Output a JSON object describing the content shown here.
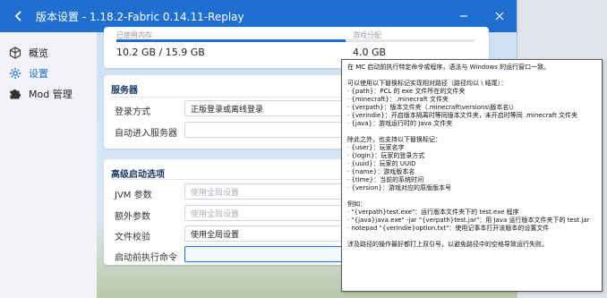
{
  "window": {
    "title": "版本设置 - 1.18.2-Fabric 0.14.11-Replay"
  },
  "sidebar": {
    "items": [
      {
        "label": "概览",
        "icon": "cube-icon"
      },
      {
        "label": "设置",
        "icon": "gear-icon",
        "active": true
      },
      {
        "label": "Mod 管理",
        "icon": "puzzle-icon"
      }
    ]
  },
  "memory": {
    "used_label": "已使用内存",
    "alloc_label": "游戏分配",
    "used_value": "10.2 GB / 15.9 GB",
    "alloc_value": "4.0 GB",
    "used_fraction": 0.64
  },
  "server": {
    "title": "服务器",
    "login_label": "登录方式",
    "login_value": "正版登录或离线登录",
    "auto_join_label": "自动进入服务器",
    "auto_join_value": ""
  },
  "advanced": {
    "title": "高级启动选项",
    "jvm_label": "JVM 参数",
    "jvm_placeholder": "使用全局设置",
    "extra_label": "额外参数",
    "extra_placeholder": "使用全局设置",
    "check_label": "文件校验",
    "check_value": "使用全局设置",
    "pre_cmd_label": "启动前执行命令",
    "pre_cmd_value": ""
  },
  "tooltip": {
    "lines": [
      "在 MC 启动前执行特定命令或程序，语法与 Windows 的运行窗口一致。",
      "",
      "可以使用以下替换标记实现相对路径（路径均以 \\ 结尾）：",
      "· {path}：PCL 的 exe 文件所在的文件夹",
      "· {minecraft}：.minecraft 文件夹",
      "· {verpath}：版本文件夹（.minecraft\\versions\\版本名\\）",
      "· {verindie}：开启版本隔离时等同版本文件夹，未开启时等同 .minecraft 文件夹",
      "· {java}：游戏运行时的 Java 文件夹",
      "",
      "除此之外，也支持以下替换标记：",
      "· {user}：玩家名字",
      "· {login}：玩家的登录方式",
      "· {uuid}：玩家的 UUID",
      "· {name}：游戏版本名",
      "· {time}：当前的系统时间",
      "· {version}：游戏对应的原版版本号",
      "",
      "例如：",
      "· \"{verpath}test.exe\"：运行版本文件夹下的 test.exe 程序",
      "· \"{java}java.exe\" -jar \"{verpath}test.jar\"：用 Java 运行版本文件夹下的 test.jar",
      "· notepad \"{verindie}option.txt\"：使用记事本打开该版本的设置文件",
      "",
      "涉及路径的操作最好都打上双引号，以避免路径中的空格导致运行失败。"
    ]
  },
  "colors": {
    "accent": "#1f6fd1",
    "section_title": "#1b3a6b"
  }
}
